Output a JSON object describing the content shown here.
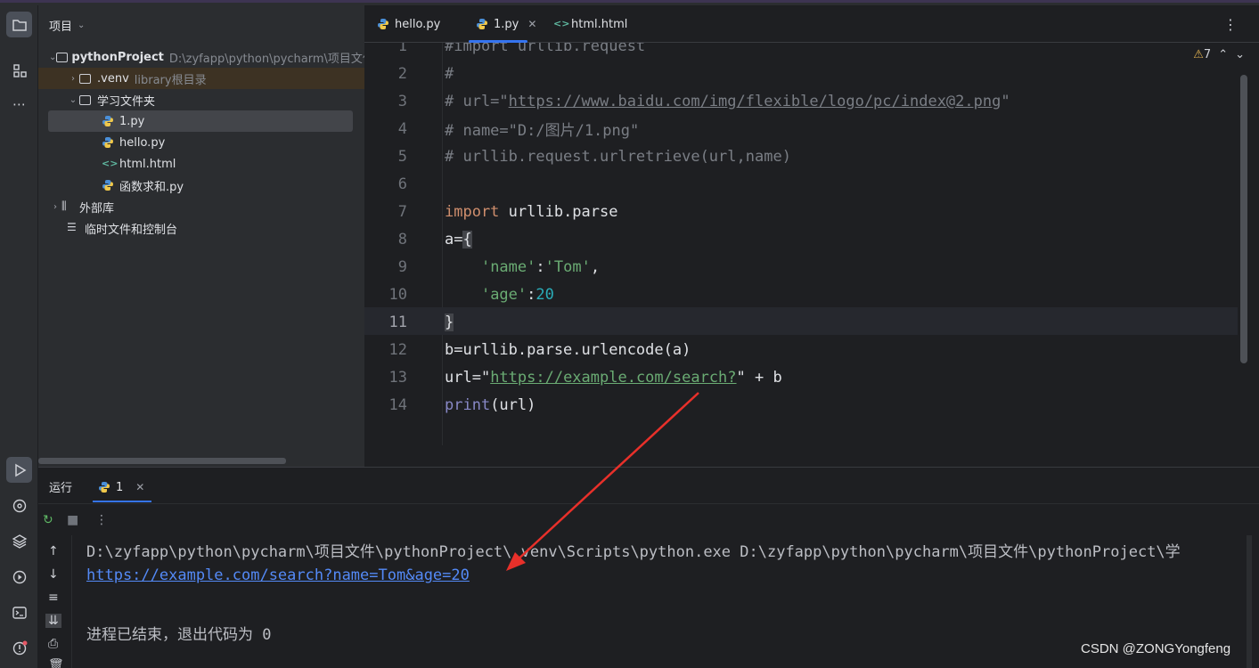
{
  "project_panel": {
    "header": "项目",
    "tree": [
      {
        "label": "pythonProject",
        "note": "D:\\zyfapp\\python\\pycharm\\项目文件"
      },
      {
        "label": ".venv",
        "note": "library根目录"
      },
      {
        "label": "学习文件夹"
      },
      {
        "label": "1.py"
      },
      {
        "label": "hello.py"
      },
      {
        "label": "html.html"
      },
      {
        "label": "函数求和.py"
      },
      {
        "label": "外部库"
      },
      {
        "label": "临时文件和控制台"
      }
    ]
  },
  "tabs": [
    {
      "label": "hello.py"
    },
    {
      "label": "1.py",
      "active": true
    },
    {
      "label": "html.html"
    }
  ],
  "editor": {
    "warning_count": "7",
    "lines": [
      {
        "n": "1",
        "text": "#import urllib.request"
      },
      {
        "n": "2",
        "text": "#"
      },
      {
        "n": "3",
        "text_prefix": "# url=\"",
        "url": "https://www.baidu.com/img/flexible/logo/pc/index@2.png",
        "text_suffix": "\""
      },
      {
        "n": "4",
        "text": "# name=\"D:/图片/1.png\""
      },
      {
        "n": "5",
        "text": "# urllib.request.urlretrieve(url,name)"
      },
      {
        "n": "6",
        "text": ""
      },
      {
        "n": "7",
        "kw": "import",
        "text": " urllib.parse"
      },
      {
        "n": "8",
        "text": "a=",
        "brace": "{"
      },
      {
        "n": "9",
        "key": "'name'",
        "sep": ":",
        "val": "'Tom'",
        "end": ","
      },
      {
        "n": "10",
        "key": "'age'",
        "sep": ":",
        "num": "20"
      },
      {
        "n": "11",
        "brace": "}"
      },
      {
        "n": "12",
        "text": "b=urllib.parse.urlencode(a)"
      },
      {
        "n": "13",
        "prefix": "url=\"",
        "url": "https://example.com/search?",
        "suffix": "\" + b"
      },
      {
        "n": "14",
        "fn": "print",
        "text": "(url)"
      }
    ]
  },
  "run_panel": {
    "title": "运行",
    "tab": "1",
    "output": [
      "D:\\zyfapp\\python\\pycharm\\项目文件\\pythonProject\\.venv\\Scripts\\python.exe D:\\zyfapp\\python\\pycharm\\项目文件\\pythonProject\\学",
      "https://example.com/search?name=Tom&age=20",
      "",
      "进程已结束，退出代码为 0"
    ]
  },
  "watermark": "CSDN @ZONGYongfeng",
  "colors": {
    "accent": "#3574f0",
    "link": "#548af7",
    "annotation_arrow": "#e8302a"
  }
}
